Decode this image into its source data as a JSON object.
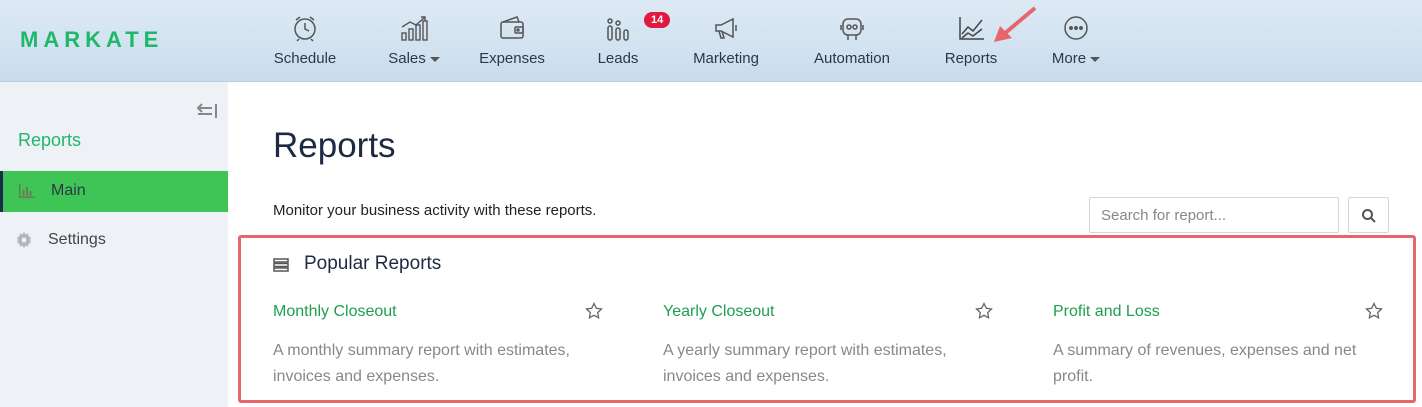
{
  "app": {
    "logo": "MARKATE"
  },
  "nav": {
    "items": [
      {
        "label": "Schedule",
        "icon": "clock-icon"
      },
      {
        "label": "Sales",
        "icon": "bar-growth-icon",
        "dropdown": true
      },
      {
        "label": "Expenses",
        "icon": "wallet-icon"
      },
      {
        "label": "Leads",
        "icon": "funnel-bars-icon",
        "badge": "14"
      },
      {
        "label": "Marketing",
        "icon": "megaphone-icon"
      },
      {
        "label": "Automation",
        "icon": "robot-icon"
      },
      {
        "label": "Reports",
        "icon": "line-chart-icon"
      },
      {
        "label": "More",
        "icon": "dots-circle-icon",
        "dropdown": true
      }
    ]
  },
  "sidebar": {
    "title": "Reports",
    "items": [
      {
        "label": "Main",
        "icon": "bar-chart-icon",
        "active": true
      },
      {
        "label": "Settings",
        "icon": "gear-icon",
        "active": false
      }
    ]
  },
  "page": {
    "title": "Reports",
    "subtitle": "Monitor your business activity with these reports.",
    "search": {
      "placeholder": "Search for report..."
    }
  },
  "popular": {
    "title": "Popular Reports",
    "cards": [
      {
        "title": "Monthly Closeout",
        "description": "A monthly summary report with estimates, invoices and expenses."
      },
      {
        "title": "Yearly Closeout",
        "description": "A yearly summary report with estimates, invoices and expenses."
      },
      {
        "title": "Profit and Loss",
        "description": "A summary of revenues, expenses and net profit."
      }
    ]
  },
  "colors": {
    "brand": "#1fb86a",
    "active_sidebar": "#3fc456",
    "link": "#1f9e4e",
    "badge": "#e0193f",
    "highlight": "#e8666b"
  }
}
